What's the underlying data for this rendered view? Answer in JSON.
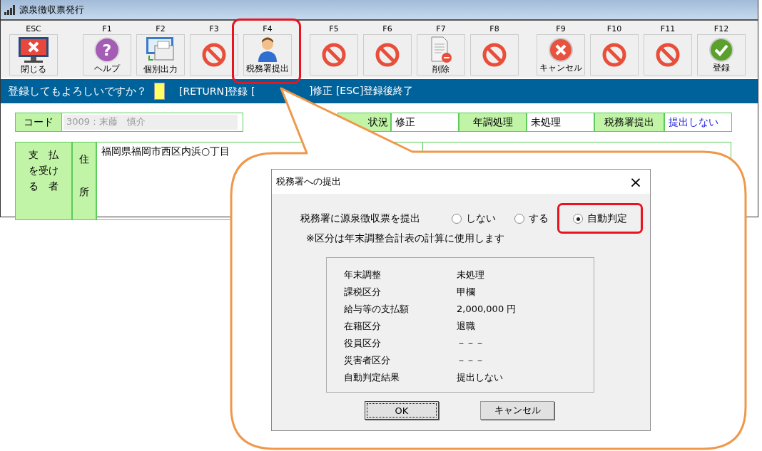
{
  "window": {
    "title": "源泉徴収票発行"
  },
  "toolbar_groups": [
    {
      "buttons": [
        {
          "key": "ESC",
          "label": "閉じる",
          "kind": "close",
          "highlighted": false
        }
      ]
    },
    {
      "buttons": [
        {
          "key": "F1",
          "label": "ヘルプ",
          "kind": "help",
          "glyph": "?",
          "highlighted": false
        },
        {
          "key": "F2",
          "label": "個別出力",
          "kind": "output",
          "highlighted": false
        },
        {
          "key": "F3",
          "kind": "disabled",
          "highlighted": false
        },
        {
          "key": "F4",
          "label": "税務署提出",
          "kind": "person",
          "highlighted": true
        }
      ]
    },
    {
      "buttons": [
        {
          "key": "F5",
          "kind": "disabled",
          "highlighted": false
        },
        {
          "key": "F6",
          "kind": "disabled",
          "highlighted": false
        },
        {
          "key": "F7",
          "label": "削除",
          "kind": "delete",
          "highlighted": false
        },
        {
          "key": "F8",
          "kind": "disabled",
          "highlighted": false
        }
      ]
    },
    {
      "buttons": [
        {
          "key": "F9",
          "label": "キャンセル",
          "kind": "cancel",
          "highlighted": false
        },
        {
          "key": "F10",
          "kind": "disabled",
          "highlighted": false
        },
        {
          "key": "F11",
          "kind": "disabled",
          "highlighted": false
        },
        {
          "key": "F12",
          "label": "登録",
          "kind": "register",
          "highlighted": false
        }
      ]
    }
  ],
  "message_bar": {
    "prompt": "登録してもよろしいですか？",
    "hint_before": "[RETURN]登録 [",
    "hint_after": "]修正 [ESC]登録後終了"
  },
  "code": {
    "label": "コード",
    "value": "3009：末藤　慎介"
  },
  "status_cells": [
    {
      "label": "状況",
      "value": "修正",
      "emphasis": false
    },
    {
      "label": "年調処理",
      "value": "未処理",
      "emphasis": false
    },
    {
      "label": "税務署提出",
      "value": "提出しない",
      "emphasis": true
    }
  ],
  "payee": {
    "label_lines": [
      "支　払",
      "を受け",
      "る　者"
    ],
    "address_label": "住所",
    "address": "福岡県福岡市西区内浜○丁目"
  },
  "dialog": {
    "title": "税務署への提出",
    "close": "×",
    "prompt": "税務署に源泉徴収票を提出",
    "options": [
      {
        "label": "しない",
        "selected": false,
        "highlighted": false
      },
      {
        "label": "する",
        "selected": false,
        "highlighted": false
      },
      {
        "label": "自動判定",
        "selected": true,
        "highlighted": true
      }
    ],
    "note": "※区分は年末調整合計表の計算に使用します",
    "summary": [
      {
        "label": "年末調整",
        "value": "未処理"
      },
      {
        "label": "課税区分",
        "value": "甲欄"
      },
      {
        "label": "給与等の支払額",
        "value": "2,000,000 円"
      },
      {
        "label": "在籍区分",
        "value": "退職"
      },
      {
        "label": "役員区分",
        "value": "－－－"
      },
      {
        "label": "災害者区分",
        "value": "－－－"
      },
      {
        "label": "自動判定結果",
        "value": "提出しない"
      }
    ],
    "buttons": [
      {
        "label": "OK",
        "focused": true
      },
      {
        "label": "キャンセル",
        "focused": false
      }
    ]
  }
}
